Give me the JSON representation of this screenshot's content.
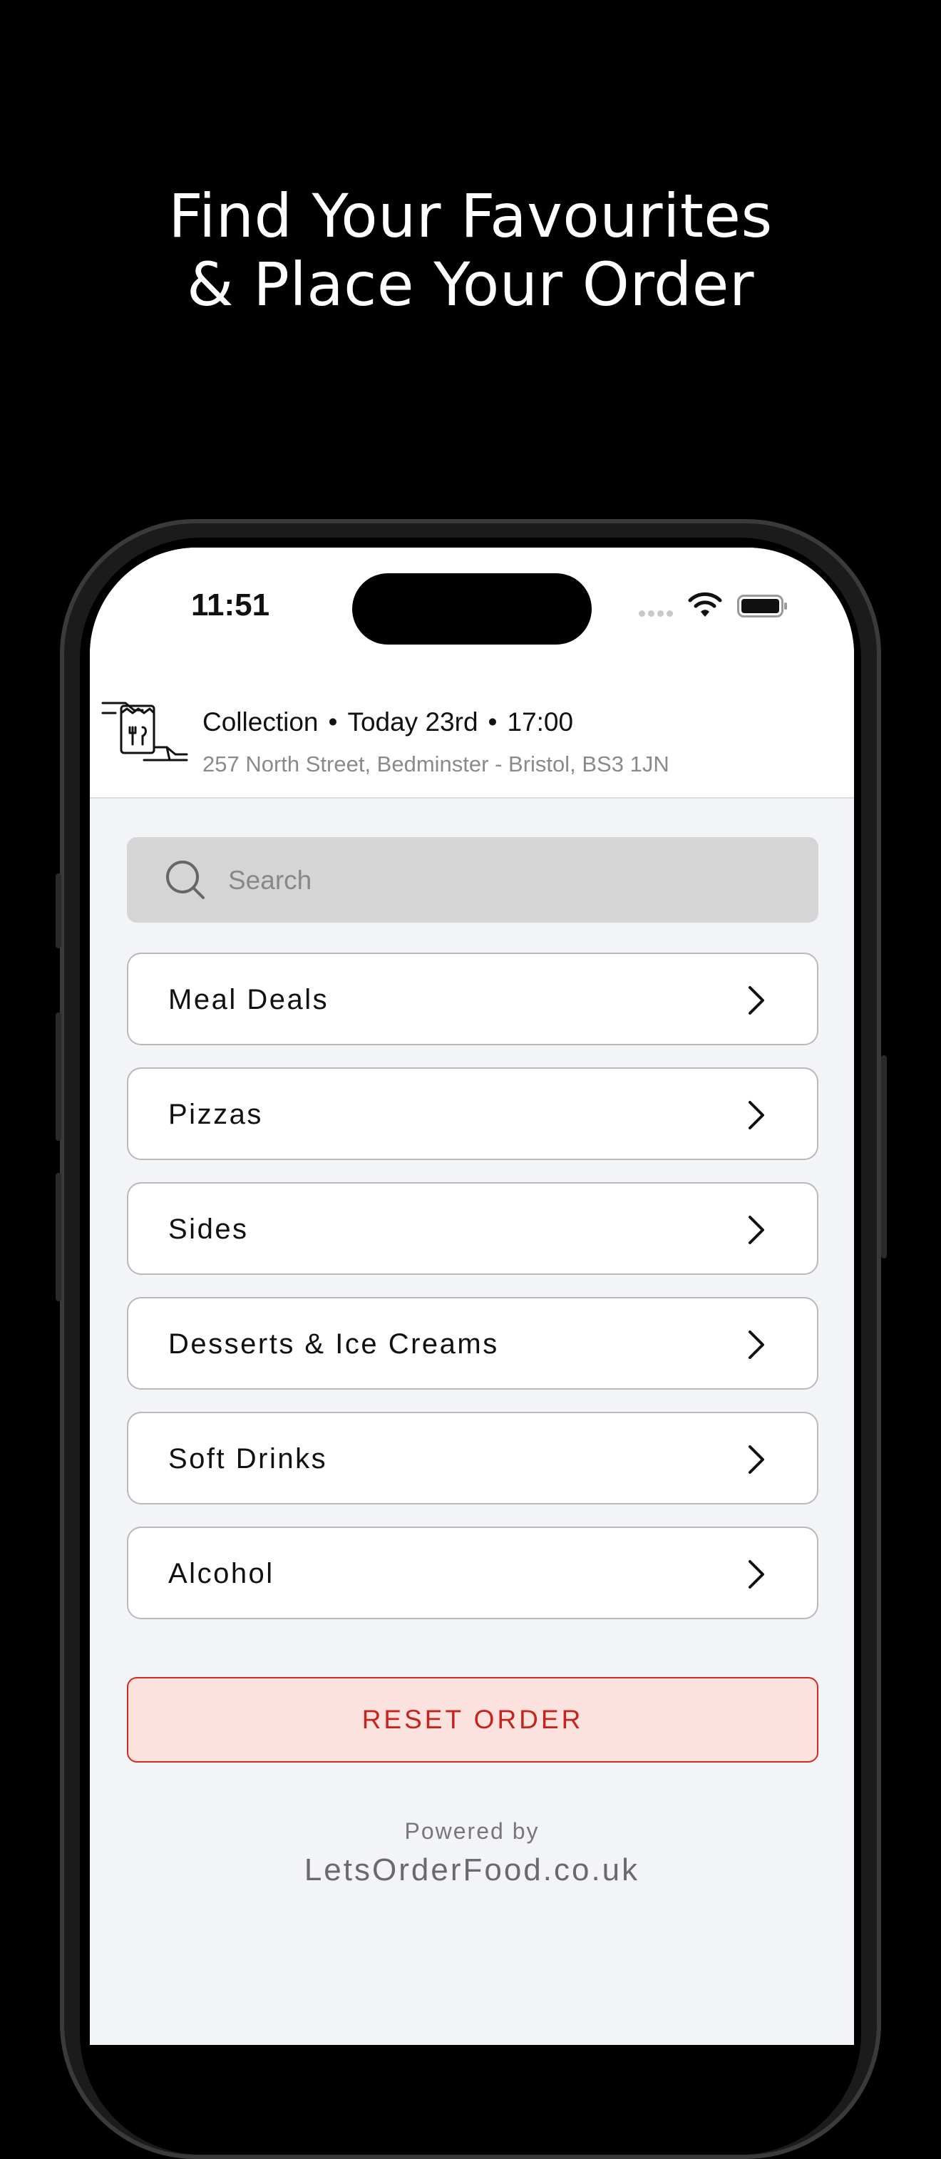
{
  "promo": {
    "headline_line1": "Find Your Favourites",
    "headline_line2": "& Place Your Order"
  },
  "status_bar": {
    "time": "11:51",
    "signal_icon": "signal-dots-icon",
    "wifi_icon": "wifi-icon",
    "battery_icon": "battery-icon"
  },
  "header": {
    "icon": "collection-bag-icon",
    "mode": "Collection",
    "separator": "•",
    "day": "Today 23rd",
    "time": "17:00",
    "address": "257 North Street, Bedminster - Bristol, BS3  1JN"
  },
  "search": {
    "placeholder": "Search",
    "value": "",
    "icon": "search-icon"
  },
  "categories": [
    {
      "label": "Meal Deals"
    },
    {
      "label": "Pizzas"
    },
    {
      "label": "Sides"
    },
    {
      "label": "Desserts & Ice Creams"
    },
    {
      "label": "Soft Drinks"
    },
    {
      "label": "Alcohol"
    }
  ],
  "reset_button": {
    "label": "RESET ORDER"
  },
  "footer": {
    "powered_by": "Powered by",
    "site": "LetsOrderFood.co.uk"
  },
  "colors": {
    "background": "#000000",
    "screen_background": "#f3f4f7",
    "accent_red": "#c4241b",
    "reset_fill": "#fbe2df",
    "search_fill": "#d5d5d5"
  }
}
